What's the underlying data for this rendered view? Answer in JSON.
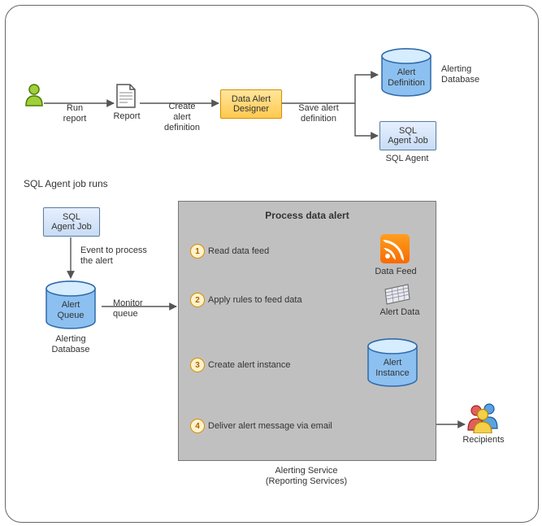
{
  "top_flow": {
    "run_report": "Run\nreport",
    "report_icon": "Report",
    "create_def": "Create\nalert\ndefinition",
    "designer_box": "Data Alert\nDesigner",
    "save_def": "Save alert\ndefinition",
    "alert_definition_cyl": "Alert\nDefinition",
    "alerting_db_label": "Alerting\nDatabase",
    "sql_agent_job_box": "SQL\nAgent Job",
    "sql_agent_label": "SQL Agent"
  },
  "section_header": "SQL Agent job runs",
  "left_flow": {
    "sql_agent_job_box": "SQL\nAgent Job",
    "event_label": "Event to process\nthe alert",
    "alert_queue_cyl": "Alert\nQueue",
    "alerting_db_label": "Alerting\nDatabase",
    "monitor_queue": "Monitor\nqueue"
  },
  "process": {
    "title": "Process data alert",
    "steps": [
      {
        "n": "1",
        "text": "Read data feed",
        "target_label": "Data Feed"
      },
      {
        "n": "2",
        "text": "Apply rules to feed data",
        "target_label": "Alert Data"
      },
      {
        "n": "3",
        "text": "Create alert instance",
        "target_label": "Alert\nInstance"
      },
      {
        "n": "4",
        "text": "Deliver alert message via email",
        "target_label": "Recipients"
      }
    ],
    "service_label": "Alerting Service\n(Reporting Services)"
  },
  "chart_data": {
    "type": "flowchart",
    "nodes": [
      {
        "id": "user",
        "label": "User",
        "kind": "actor"
      },
      {
        "id": "report",
        "label": "Report",
        "kind": "document"
      },
      {
        "id": "designer",
        "label": "Data Alert Designer",
        "kind": "process-highlight"
      },
      {
        "id": "alert_def",
        "label": "Alert Definition",
        "kind": "datastore",
        "db": "Alerting Database"
      },
      {
        "id": "sql_job_top",
        "label": "SQL Agent Job",
        "kind": "object",
        "system": "SQL Agent"
      },
      {
        "id": "sql_job_left",
        "label": "SQL Agent Job",
        "kind": "object"
      },
      {
        "id": "alert_queue",
        "label": "Alert Queue",
        "kind": "datastore",
        "db": "Alerting Database"
      },
      {
        "id": "alerting_service",
        "label": "Alerting Service (Reporting Services)",
        "kind": "container",
        "title": "Process data alert"
      },
      {
        "id": "data_feed",
        "label": "Data Feed",
        "kind": "feed"
      },
      {
        "id": "alert_data",
        "label": "Alert Data",
        "kind": "dataset"
      },
      {
        "id": "alert_instance",
        "label": "Alert Instance",
        "kind": "datastore"
      },
      {
        "id": "recipients",
        "label": "Recipients",
        "kind": "actors"
      }
    ],
    "edges": [
      {
        "from": "user",
        "to": "report",
        "label": "Run report"
      },
      {
        "from": "report",
        "to": "designer",
        "label": "Create alert definition"
      },
      {
        "from": "designer",
        "to": "alert_def",
        "label": "Save alert definition"
      },
      {
        "from": "designer",
        "to": "sql_job_top",
        "label": "Save alert definition"
      },
      {
        "from": "sql_job_left",
        "to": "alert_queue",
        "label": "Event to process the alert"
      },
      {
        "from": "alert_queue",
        "to": "alerting_service",
        "label": "Monitor queue"
      },
      {
        "from": "data_feed",
        "to": "step1",
        "label": "Read data feed",
        "step": 1
      },
      {
        "from": "step2",
        "to": "alert_data",
        "label": "Apply rules to feed data",
        "step": 2
      },
      {
        "from": "step3",
        "to": "alert_instance",
        "label": "Create alert instance",
        "step": 3
      },
      {
        "from": "step4",
        "to": "recipients",
        "label": "Deliver alert message via email",
        "step": 4
      }
    ]
  }
}
